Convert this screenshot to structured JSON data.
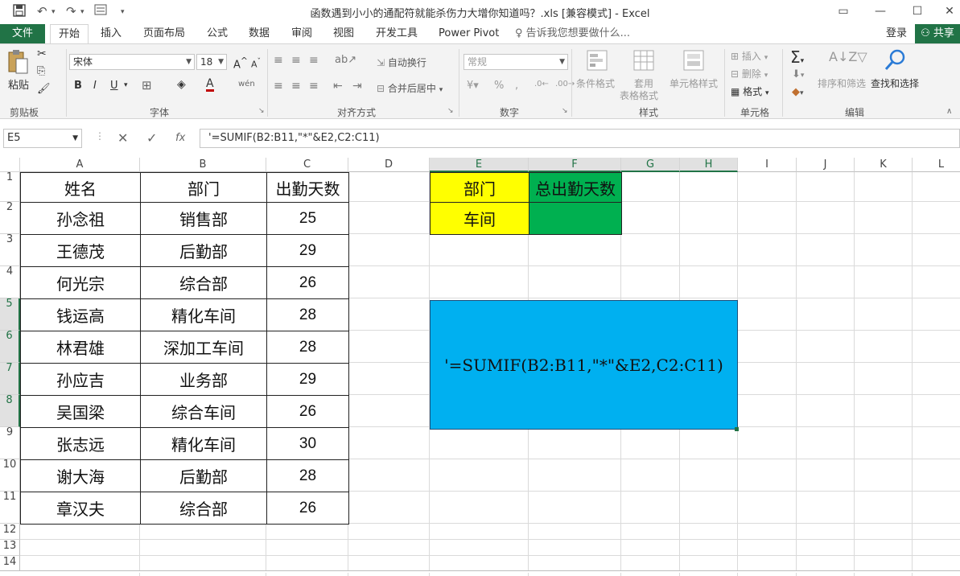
{
  "window": {
    "title": "函数遇到小小的通配符就能杀伤力大增你知道吗？.xls  [兼容模式] - Excel"
  },
  "tabs": {
    "file": "文件",
    "items": [
      "开始",
      "插入",
      "页面布局",
      "公式",
      "数据",
      "审阅",
      "视图",
      "开发工具",
      "Power Pivot"
    ],
    "tell_me": "告诉我您想要做什么...",
    "login": "登录",
    "share": "共享"
  },
  "ribbon": {
    "clipboard": {
      "paste": "粘贴",
      "label": "剪贴板"
    },
    "font": {
      "name": "宋体",
      "size": "18",
      "label": "字体",
      "bold": "B",
      "italic": "I",
      "underline": "U"
    },
    "alignment": {
      "wrap": "自动换行",
      "merge": "合并后居中",
      "label": "对齐方式"
    },
    "number": {
      "format": "常规",
      "label": "数字",
      "percent": "%",
      "comma": ","
    },
    "styles": {
      "conditional": "条件格式",
      "table1": "套用",
      "table2": "表格格式",
      "cell_styles": "单元格样式",
      "label": "样式"
    },
    "cells": {
      "insert": "插入",
      "delete": "删除",
      "format": "格式",
      "label": "单元格"
    },
    "editing": {
      "sort": "排序和筛选",
      "find": "查找和选择",
      "label": "编辑"
    }
  },
  "formula_bar": {
    "name_box": "E5",
    "cancel": "✕",
    "enter": "✓",
    "fx": "fx",
    "formula": "'=SUMIF(B2:B11,\"*\"&E2,C2:C11)"
  },
  "columns": [
    "A",
    "B",
    "C",
    "D",
    "E",
    "F",
    "G",
    "H",
    "I",
    "J",
    "K",
    "L"
  ],
  "rows": [
    "1",
    "2",
    "3",
    "4",
    "5",
    "6",
    "7",
    "8",
    "9",
    "10",
    "11",
    "12",
    "13",
    "14"
  ],
  "table": {
    "headers": [
      "姓名",
      "部门",
      "出勤天数"
    ],
    "rows": [
      [
        "孙念祖",
        "销售部",
        "25"
      ],
      [
        "王德茂",
        "后勤部",
        "29"
      ],
      [
        "何光宗",
        "综合部",
        "26"
      ],
      [
        "钱运高",
        "精化车间",
        "28"
      ],
      [
        "林君雄",
        "深加工车间",
        "28"
      ],
      [
        "孙应吉",
        "业务部",
        "29"
      ],
      [
        "吴国梁",
        "综合车间",
        "26"
      ],
      [
        "张志远",
        "精化车间",
        "30"
      ],
      [
        "谢大海",
        "后勤部",
        "28"
      ],
      [
        "章汉夫",
        "综合部",
        "26"
      ]
    ]
  },
  "lookup": {
    "dept_header": "部门",
    "total_header": "总出勤天数",
    "dept_value": "车间",
    "total_value": ""
  },
  "textbox": {
    "text": "'=SUMIF(B2:B11,\"*\"&E2,C2:C11)"
  },
  "colors": {
    "excel_green": "#217346",
    "yellow": "#ffff00",
    "green": "#00b050",
    "textbox_blue": "#00b0f0"
  }
}
